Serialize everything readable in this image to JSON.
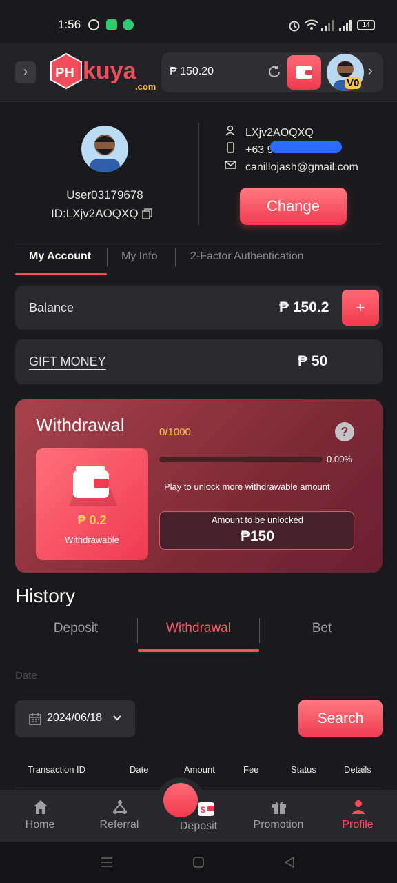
{
  "status_bar": {
    "time": "1:56",
    "battery": "14"
  },
  "header": {
    "logo_text": "PHkuya",
    "logo_suffix": ".com",
    "balance": "₱ 150.20",
    "vip_badge": "V0"
  },
  "profile": {
    "username": "User03179678",
    "id_label": "ID:LXjv2AOQXQ",
    "account_id": "LXjv2AOQXQ",
    "phone_prefix": "+63 9",
    "email": "canillojash@gmail.com",
    "change_label": "Change"
  },
  "account_tabs": [
    "My Account",
    "My Info",
    "2-Factor Authentication"
  ],
  "balance_card": {
    "label": "Balance",
    "value": "₱ 150.2",
    "plus": "+"
  },
  "gift_card": {
    "label": "GIFT MONEY",
    "value": "₱ 50"
  },
  "withdrawal": {
    "title": "Withdrawal",
    "counter": "0/1000",
    "help": "?",
    "progress_percent": 0,
    "progress_text": "0.00%",
    "hint": "Play to unlock more withdrawable amount",
    "withdrawable_amount": "₱ 0.2",
    "withdrawable_label": "Withdrawable",
    "unlock_label": "Amount to be unlocked",
    "unlock_value": "₱150"
  },
  "history": {
    "title": "History",
    "tabs": [
      "Deposit",
      "Withdrawal",
      "Bet"
    ],
    "date_label": "Date",
    "date_value": "2024/06/18",
    "search_label": "Search",
    "columns": [
      "Transaction ID",
      "Date",
      "Amount",
      "Fee",
      "Status",
      "Details"
    ]
  },
  "bottom_nav": [
    {
      "label": "Home",
      "icon": "home-icon"
    },
    {
      "label": "Referral",
      "icon": "referral-icon"
    },
    {
      "label": "Deposit",
      "icon": "deposit-icon"
    },
    {
      "label": "Promotion",
      "icon": "gift-icon"
    },
    {
      "label": "Profile",
      "icon": "profile-icon"
    }
  ],
  "colors": {
    "accent": "#ff4d5e",
    "gold": "#f4c542",
    "background": "#1a1a1d"
  }
}
